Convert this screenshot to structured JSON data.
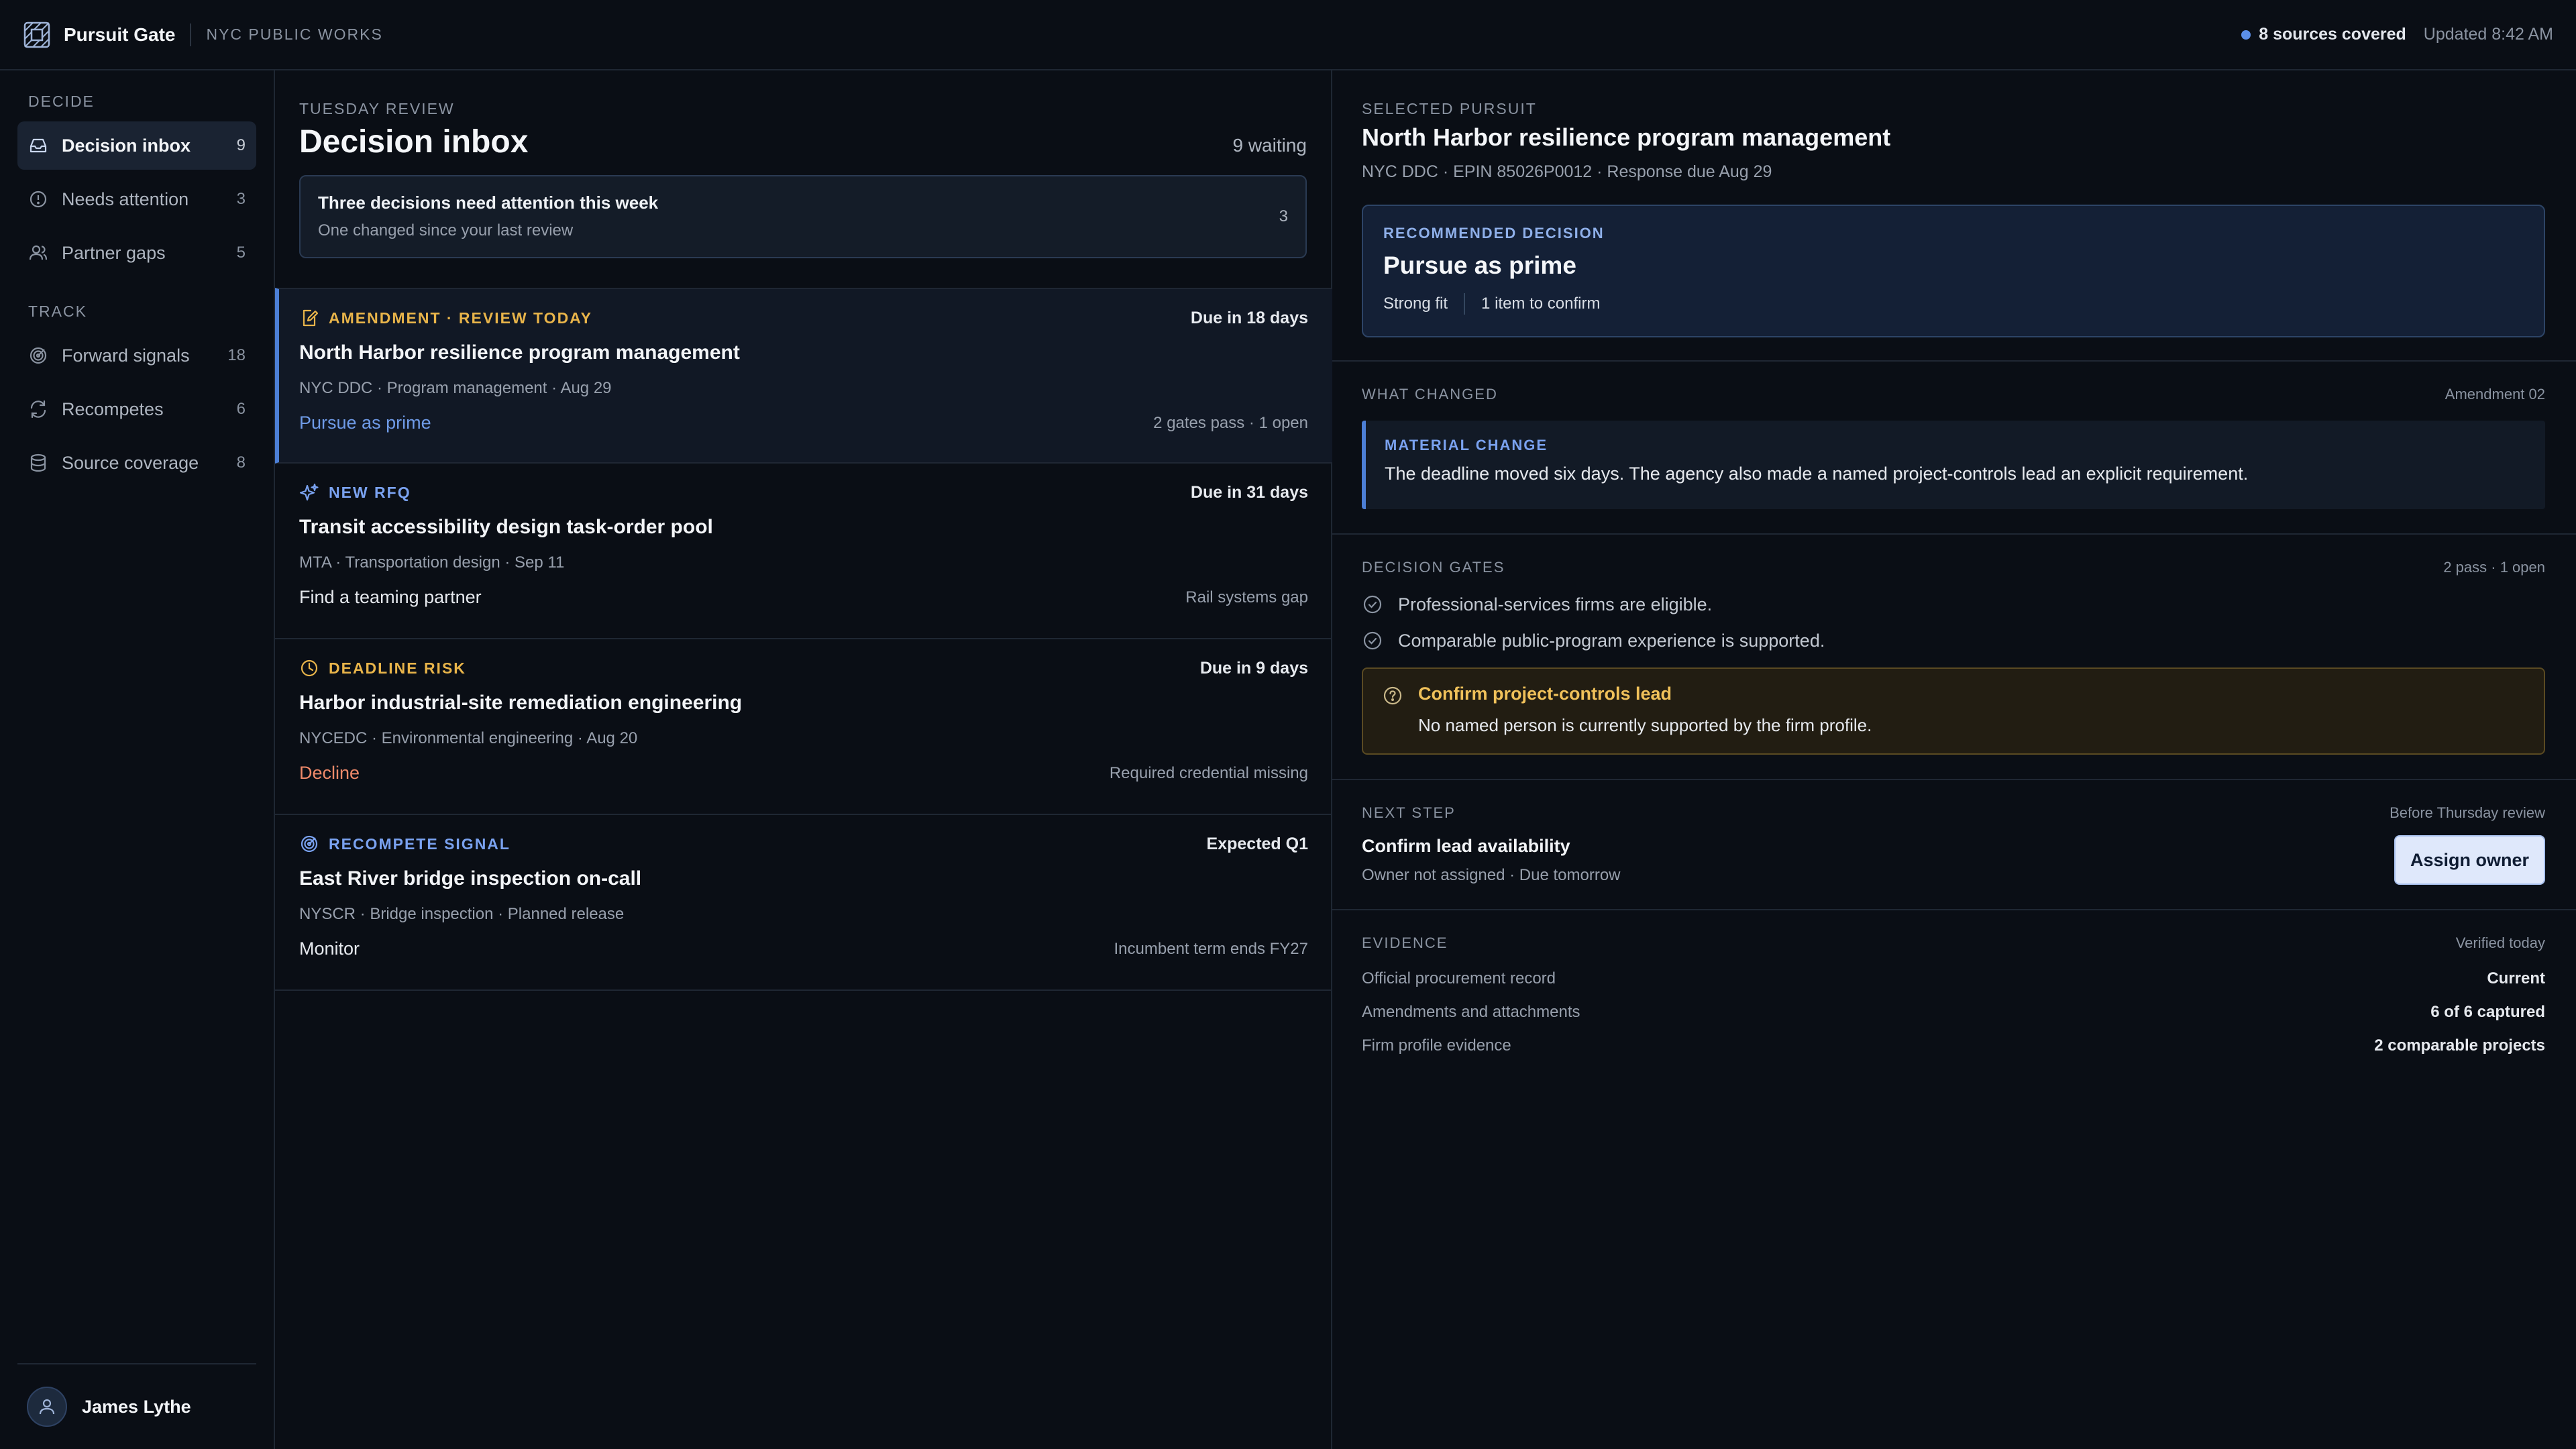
{
  "app": {
    "name": "Pursuit Gate",
    "org": "NYC PUBLIC WORKS"
  },
  "topbar": {
    "sources": "8 sources covered",
    "updated": "Updated 8:42 AM"
  },
  "sidebar": {
    "decide_label": "DECIDE",
    "track_label": "TRACK",
    "decide_items": [
      {
        "label": "Decision inbox",
        "count": "9",
        "icon": "inbox-icon"
      },
      {
        "label": "Needs attention",
        "count": "3",
        "icon": "alert-circle-icon"
      },
      {
        "label": "Partner gaps",
        "count": "5",
        "icon": "users-icon"
      }
    ],
    "track_items": [
      {
        "label": "Forward signals",
        "count": "18",
        "icon": "radar-icon"
      },
      {
        "label": "Recompetes",
        "count": "6",
        "icon": "refresh-icon"
      },
      {
        "label": "Source coverage",
        "count": "8",
        "icon": "database-icon"
      }
    ],
    "user": {
      "name": "James Lythe"
    }
  },
  "inbox": {
    "eyebrow": "TUESDAY REVIEW",
    "title": "Decision inbox",
    "waiting": "9 waiting",
    "alert": {
      "title": "Three decisions need attention this week",
      "subtitle": "One changed since your last review",
      "count": "3"
    },
    "cards": [
      {
        "tag": "AMENDMENT · REVIEW TODAY",
        "tag_icon": "edit-document-icon",
        "due": "Due in 18 days",
        "title": "North Harbor resilience program management",
        "meta": "NYC DDC · Program management · Aug 29",
        "action": "Pursue as prime",
        "note": "2 gates pass · 1 open"
      },
      {
        "tag": "NEW RFQ",
        "tag_icon": "sparkle-icon",
        "due": "Due in 31 days",
        "title": "Transit accessibility design task-order pool",
        "meta": "MTA · Transportation design · Sep 11",
        "action": "Find a teaming partner",
        "note": "Rail systems gap"
      },
      {
        "tag": "DEADLINE RISK",
        "tag_icon": "clock-icon",
        "due": "Due in 9 days",
        "title": "Harbor industrial-site remediation engineering",
        "meta": "NYCEDC · Environmental engineering · Aug 20",
        "action": "Decline",
        "note": "Required credential missing"
      },
      {
        "tag": "RECOMPETE SIGNAL",
        "tag_icon": "radar-icon",
        "due": "Expected Q1",
        "title": "East River bridge inspection on-call",
        "meta": "NYSCR · Bridge inspection · Planned release",
        "action": "Monitor",
        "note": "Incumbent term ends FY27"
      }
    ]
  },
  "detail": {
    "eyebrow": "SELECTED PURSUIT",
    "title": "North Harbor resilience program management",
    "meta": "NYC DDC · EPIN 85026P0012 · Response due Aug 29",
    "recommendation": {
      "eyebrow": "RECOMMENDED DECISION",
      "title": "Pursue as prime",
      "fit": "Strong fit",
      "confirm": "1 item to confirm"
    },
    "what_changed": {
      "label": "WHAT CHANGED",
      "right": "Amendment 02",
      "eyebrow": "MATERIAL CHANGE",
      "text": "The deadline moved six days. The agency also made a named project-controls lead an explicit requirement."
    },
    "gates": {
      "label": "DECISION GATES",
      "right": "2 pass · 1 open",
      "items": [
        "Professional-services firms are eligible.",
        "Comparable public-program experience is supported."
      ],
      "open_title": "Confirm project-controls lead",
      "open_text": "No named person is currently supported by the firm profile."
    },
    "next_step": {
      "label": "NEXT STEP",
      "right": "Before Thursday review",
      "title": "Confirm lead availability",
      "sub": "Owner not assigned · Due tomorrow",
      "button": "Assign owner"
    },
    "evidence": {
      "label": "EVIDENCE",
      "right": "Verified today",
      "rows": [
        {
          "label": "Official procurement record",
          "value": "Current"
        },
        {
          "label": "Amendments and attachments",
          "value": "6 of 6 captured"
        },
        {
          "label": "Firm profile evidence",
          "value": "2 comparable projects"
        }
      ]
    }
  },
  "colors": {
    "accent": "#4c7fd6",
    "amber": "#e8b44a",
    "danger": "#f08a6a",
    "background": "#0a0e15"
  }
}
